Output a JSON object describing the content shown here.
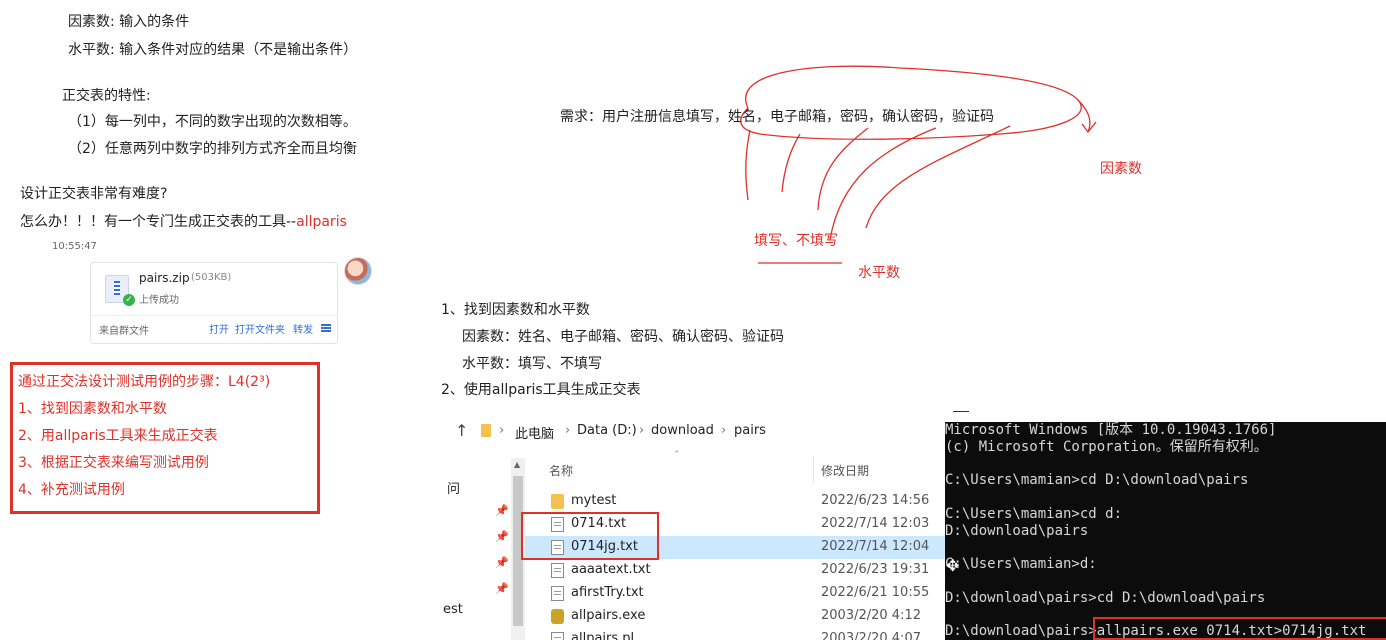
{
  "notes": {
    "factor_label": "因素数:",
    "factor_value": "输入的条件",
    "level_label": "水平数:",
    "level_value": "输入条件对应的结果（不是输出条件）",
    "props_title": "正交表的特性:",
    "prop1": "（1）每一列中，不同的数字出现的次数相等。",
    "prop2": "（2）任意两列中数字的排列方式齐全而且均衡",
    "hard_q": "设计正交表非常有难度?",
    "tool_line_prefix": "怎么办！！！有一个专门生成正交表的工具--",
    "tool_name": "allparis"
  },
  "chat": {
    "timestamp": "10:55:47",
    "file_name": "pairs.zip",
    "file_size": "(503KB)",
    "status": "上传成功",
    "source": "来自群文件",
    "actions": [
      "打开",
      "打开文件夹",
      "转发"
    ]
  },
  "steps": {
    "title": "通过正交法设计测试用例的步骤：L4(2³)",
    "items": [
      "1、找到因素数和水平数",
      "2、用allparis工具来生成正交表",
      "3、根据正交表来编写测试用例",
      "4、补充测试用例"
    ]
  },
  "diagram": {
    "requirement": "需求：用户注册信息填写，姓名，电子邮箱，密码，确认密码，验证码",
    "factor_tag": "因素数",
    "fill_tag": "填写、不填写",
    "level_tag": "水平数"
  },
  "guide": {
    "step1": "1、找到因素数和水平数",
    "factors": "因素数：姓名、电子邮箱、密码、确认密码、验证码",
    "levels": "水平数：填写、不填写",
    "step2": "2、使用allparis工具生成正交表"
  },
  "explorer": {
    "breadcrumb": [
      "此电脑",
      "Data (D:)",
      "download",
      "pairs"
    ],
    "col_name": "名称",
    "col_date": "修改日期",
    "sidebar_labels": [
      "问",
      "est"
    ],
    "files": [
      {
        "name": "mytest",
        "date": "2022/6/23 14:56",
        "type": "folder"
      },
      {
        "name": "0714.txt",
        "date": "2022/7/14 12:03",
        "type": "txt"
      },
      {
        "name": "0714jg.txt",
        "date": "2022/7/14 12:04",
        "type": "txt"
      },
      {
        "name": "aaaatext.txt",
        "date": "2022/6/23 19:31",
        "type": "txt"
      },
      {
        "name": "afirstTry.txt",
        "date": "2022/6/21 10:55",
        "type": "txt"
      },
      {
        "name": "allpairs.exe",
        "date": "2003/2/20 4:12",
        "type": "exe"
      },
      {
        "name": "allpairs.pl",
        "date": "2003/2/20 4:07",
        "type": "txt"
      }
    ]
  },
  "terminal": {
    "lines": [
      "Microsoft Windows [版本 10.0.19043.1766]",
      "(c) Microsoft Corporation。保留所有权利。",
      "",
      "C:\\Users\\mamian>cd D:\\download\\pairs",
      "",
      "C:\\Users\\mamian>cd d:",
      "D:\\download\\pairs",
      "",
      "C:\\Users\\mamian>d:",
      "",
      "D:\\download\\pairs>cd D:\\download\\pairs",
      "",
      "D:\\download\\pairs>allpairs.exe 0714.txt>0714jg.txt"
    ]
  },
  "colors": {
    "accent_red": "#e0302a",
    "link_blue": "#2f6fd8",
    "selection": "#cce8ff",
    "terminal_bg": "#0c0c0c"
  }
}
